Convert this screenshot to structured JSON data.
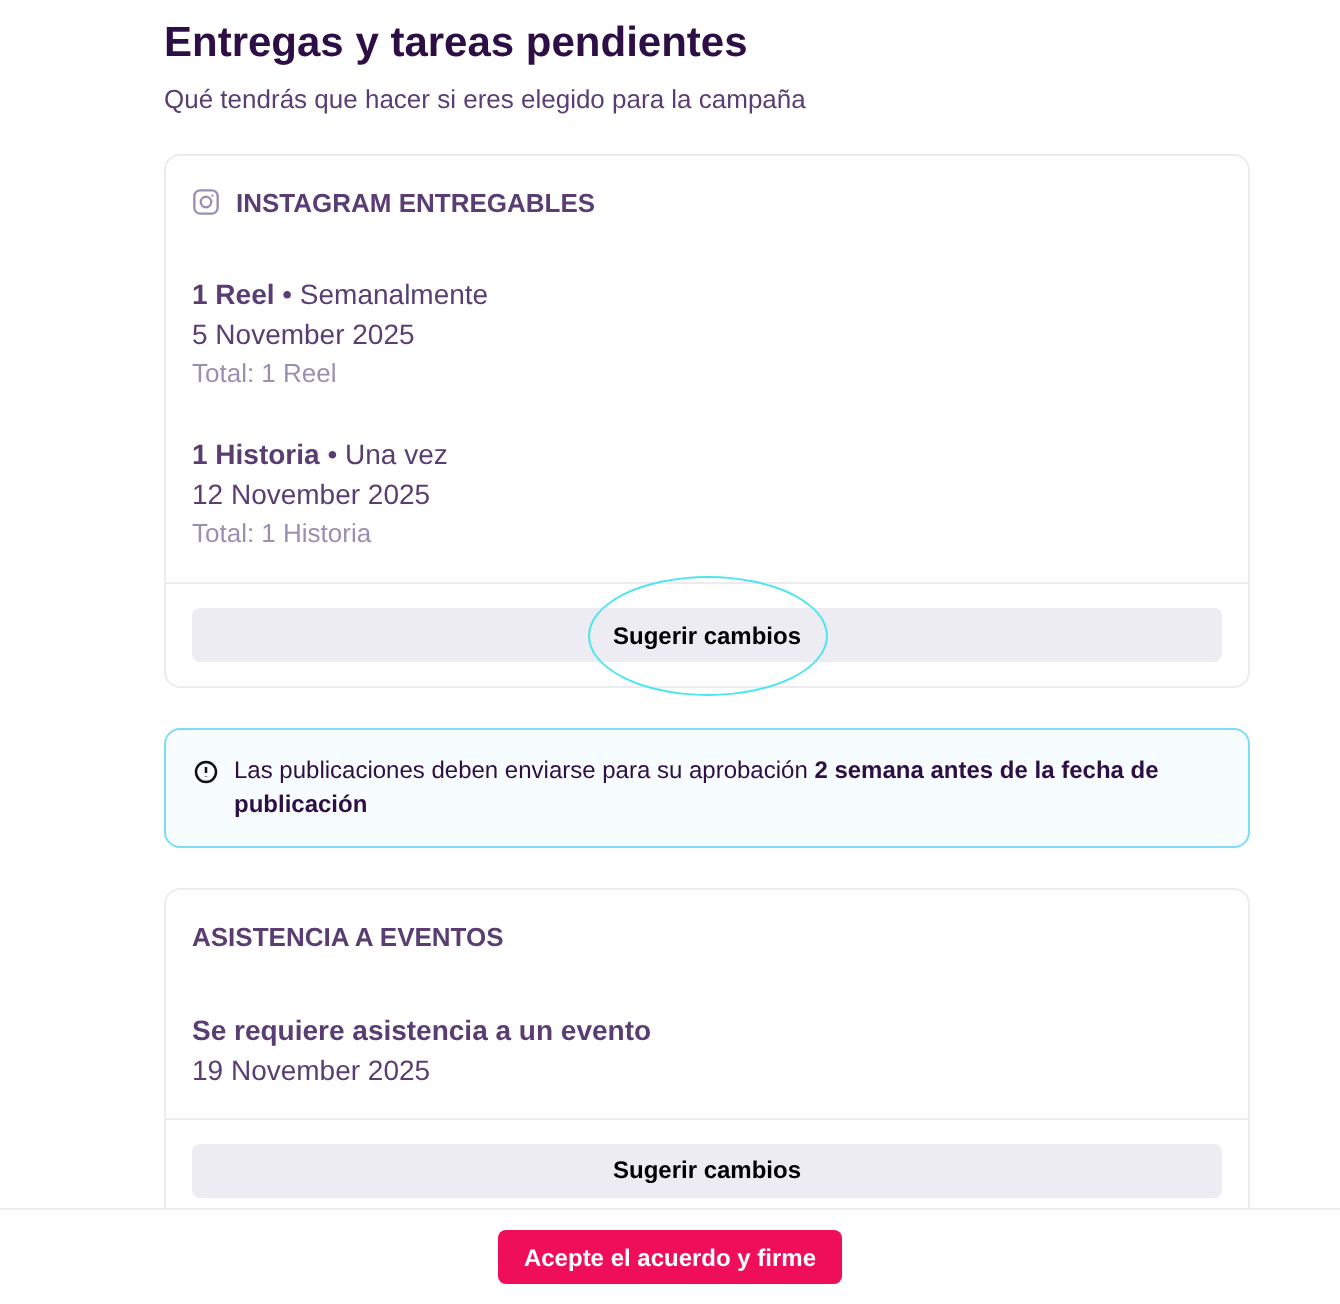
{
  "header": {
    "title": "Entregas y tareas pendientes",
    "subtitle": "Qué tendrás que hacer si eres elegido para la campaña"
  },
  "sections": [
    {
      "kind": "social_deliverables",
      "title": "INSTAGRAM ENTREGABLES",
      "items": [
        {
          "line": "**1 Reel** • Semanalmente",
          "date": "5 November 2025",
          "total": "Total: 1 Reel"
        },
        {
          "line": "**1 Historia** • Una vez",
          "date": "12 November 2025",
          "total": "Total: 1 Historia"
        }
      ],
      "button": {
        "label": "Sugerir cambios",
        "highlighted": true
      }
    },
    {
      "kind": "notice",
      "text": "Las publicaciones deben enviarse para su aprobación **2 semana antes de la fecha de publicación**"
    },
    {
      "kind": "event_deliverables",
      "title": "ASISTENCIA A EVENTOS",
      "items": [
        {
          "line": "**Se requiere asistencia a un evento**",
          "date": "19 November 2025"
        }
      ],
      "button": {
        "label": "Sugerir cambios",
        "highlighted": false
      }
    }
  ],
  "footer": {
    "button": "Acepte el acuerdo y firme"
  }
}
